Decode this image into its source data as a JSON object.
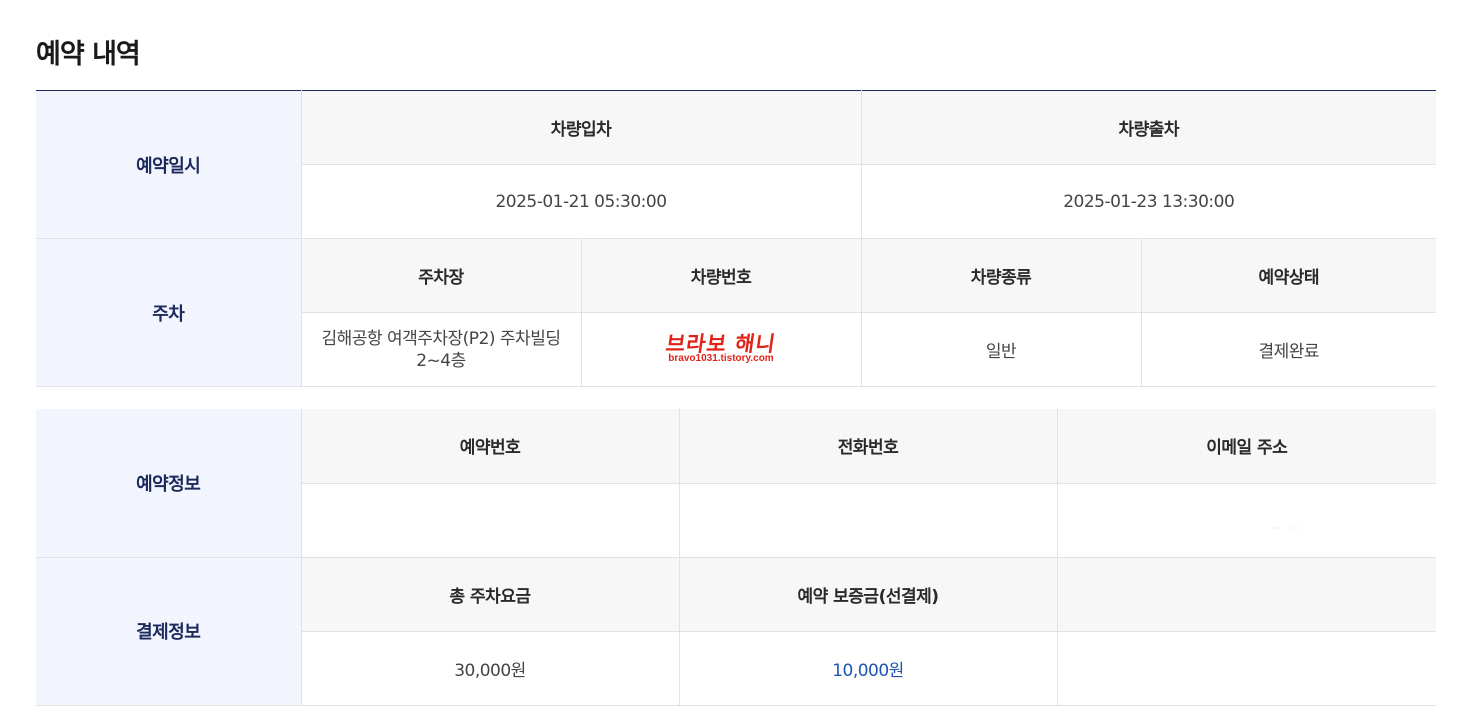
{
  "page": {
    "title": "예약 내역"
  },
  "schedule": {
    "label": "예약일시",
    "entry_header": "차량입차",
    "exit_header": "차량출차",
    "entry_value": "2025-01-21 05:30:00",
    "exit_value": "2025-01-23 13:30:00"
  },
  "parking": {
    "label": "주차",
    "headers": {
      "lot": "주차장",
      "plate": "차량번호",
      "vehicle_type": "차량종류",
      "status": "예약상태"
    },
    "values": {
      "lot_line1": "김해공항 여객주차장(P2) 주차빌딩",
      "lot_line2": "2~4층",
      "plate_watermark": "브라보 해니",
      "plate_watermark_url": "bravo1031.tistory.com",
      "vehicle_type": "일반",
      "status": "결제완료"
    }
  },
  "reservation_info": {
    "label": "예약정보",
    "headers": {
      "number": "예약번호",
      "phone": "전화번호",
      "email": "이메일 주소"
    },
    "values": {
      "number": "",
      "phone": "",
      "email": ""
    }
  },
  "payment_info": {
    "label": "결제정보",
    "headers": {
      "total_fee": "총 주차요금",
      "deposit": "예약 보증금(선결제)",
      "extra": ""
    },
    "values": {
      "total_fee": "30,000원",
      "deposit": "10,000원",
      "extra": ""
    }
  },
  "colors": {
    "row_header_bg": "#f2f5fd",
    "row_header_text": "#1c2a5c",
    "col_header_bg": "#f7f7f7",
    "accent_blue": "#1d55b5",
    "watermark_red": "#e0241a"
  }
}
